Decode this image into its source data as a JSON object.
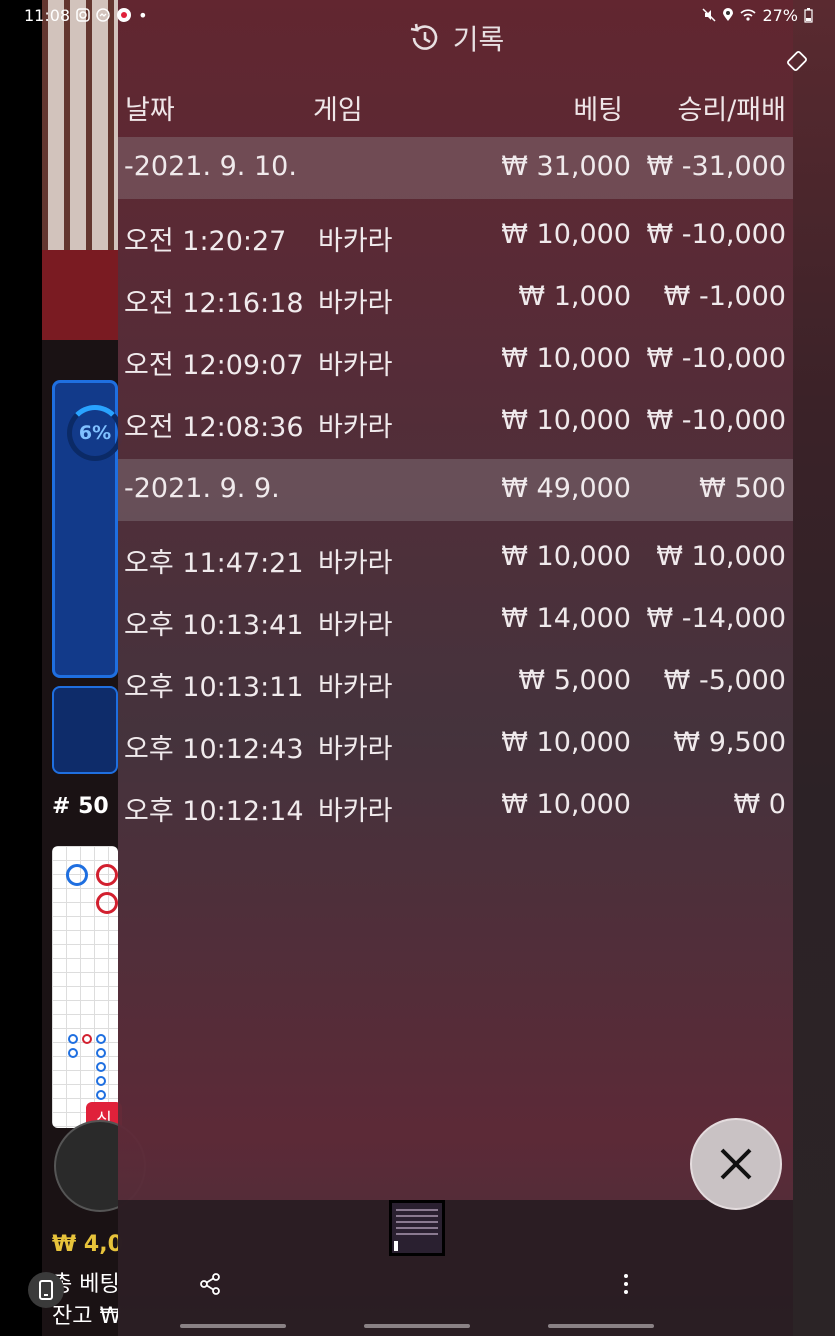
{
  "status_bar": {
    "time": "11:08",
    "battery": "27%"
  },
  "panel": {
    "title": "기록",
    "columns": {
      "date": "날짜",
      "game": "게임",
      "bet": "베팅",
      "winloss": "승리/패배"
    },
    "rows": [
      {
        "type": "date",
        "time": "-2021. 9. 10.",
        "game": "",
        "bet": "₩ 31,000",
        "winloss": "₩ -31,000"
      },
      {
        "type": "entry",
        "time": "오전 1:20:27",
        "game": "바카라",
        "bet": "₩ 10,000",
        "winloss": "₩ -10,000"
      },
      {
        "type": "entry",
        "time": "오전 12:16:18",
        "game": "바카라",
        "bet": "₩ 1,000",
        "winloss": "₩ -1,000"
      },
      {
        "type": "entry",
        "time": "오전 12:09:07",
        "game": "바카라",
        "bet": "₩ 10,000",
        "winloss": "₩ -10,000"
      },
      {
        "type": "entry",
        "time": "오전 12:08:36",
        "game": "바카라",
        "bet": "₩ 10,000",
        "winloss": "₩ -10,000"
      },
      {
        "type": "date",
        "time": "-2021. 9. 9.",
        "game": "",
        "bet": "₩ 49,000",
        "winloss": "₩ 500"
      },
      {
        "type": "entry",
        "time": "오후 11:47:21",
        "game": "바카라",
        "bet": "₩ 10,000",
        "winloss": "₩ 10,000"
      },
      {
        "type": "entry",
        "time": "오후 10:13:41",
        "game": "바카라",
        "bet": "₩ 14,000",
        "winloss": "₩ -14,000"
      },
      {
        "type": "entry",
        "time": "오후 10:13:11",
        "game": "바카라",
        "bet": "₩ 5,000",
        "winloss": "₩ -5,000"
      },
      {
        "type": "entry",
        "time": "오후 10:12:43",
        "game": "바카라",
        "bet": "₩ 10,000",
        "winloss": "₩ 9,500"
      },
      {
        "type": "entry",
        "time": "오후 10:12:14",
        "game": "바카라",
        "bet": "₩ 10,000",
        "winloss": "₩ 0"
      }
    ]
  },
  "background": {
    "timer_percent": "6%",
    "round_label": "# 50",
    "new_badge": "신",
    "balance_line1": "₩ 4,0",
    "balance_line2": "총 베팅",
    "balance_line3": "잔고 ₩"
  }
}
